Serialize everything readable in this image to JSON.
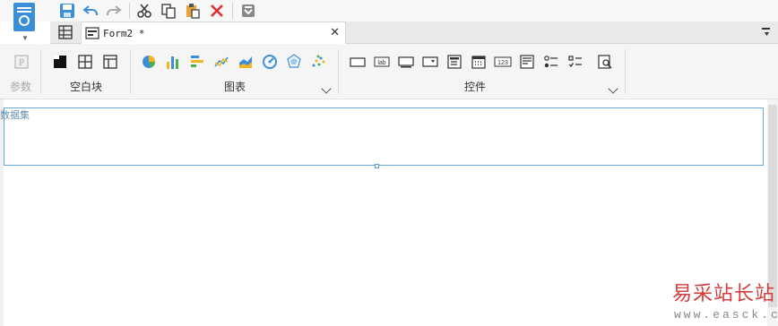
{
  "tab": {
    "label": "Form2 *",
    "close": "✕"
  },
  "ribbon": {
    "params_label": "参数",
    "blank_block_label": "空白块",
    "charts_label": "图表",
    "widgets_label": "控件"
  },
  "canvas": {
    "param_panel_label": "数据集"
  },
  "watermark": {
    "title": "易采站长站",
    "url": "www.easck.com"
  },
  "colors": {
    "accent": "#3a8fd8",
    "panel_border": "#6aa8d8",
    "watermark_red": "#d23c3c"
  }
}
